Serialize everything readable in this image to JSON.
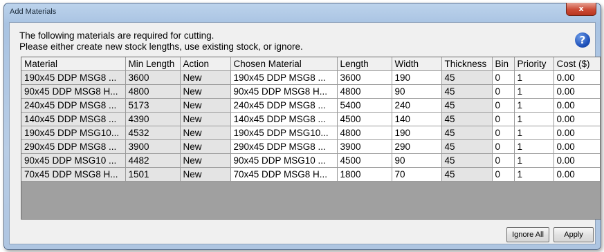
{
  "dialog": {
    "title": "Add Materials",
    "close_label": "x",
    "message_line1": "The following materials are required for cutting.",
    "message_line2": "Please either create new stock lengths, use existing stock, or ignore.",
    "help_label": "?"
  },
  "table": {
    "columns": [
      "Material",
      "Min Length",
      "Action",
      "Chosen Material",
      "Length",
      "Width",
      "Thickness",
      "Bin",
      "Priority",
      "Cost ($)"
    ],
    "rows": [
      [
        "190x45 DDP MSG8 ...",
        "3600",
        "New",
        "190x45 DDP MSG8 ...",
        "3600",
        "190",
        "45",
        "0",
        "1",
        "0.00"
      ],
      [
        "90x45 DDP MSG8 H...",
        "4800",
        "New",
        "90x45 DDP MSG8 H...",
        "4800",
        "90",
        "45",
        "0",
        "1",
        "0.00"
      ],
      [
        "240x45 DDP MSG8 ...",
        "5173",
        "New",
        "240x45 DDP MSG8 ...",
        "5400",
        "240",
        "45",
        "0",
        "1",
        "0.00"
      ],
      [
        "140x45 DDP MSG8 ...",
        "4390",
        "New",
        "140x45 DDP MSG8 ...",
        "4500",
        "140",
        "45",
        "0",
        "1",
        "0.00"
      ],
      [
        "190x45 DDP MSG10...",
        "4532",
        "New",
        "190x45 DDP MSG10...",
        "4800",
        "190",
        "45",
        "0",
        "1",
        "0.00"
      ],
      [
        "290x45 DDP MSG8 ...",
        "3900",
        "New",
        "290x45 DDP MSG8 ...",
        "3900",
        "290",
        "45",
        "0",
        "1",
        "0.00"
      ],
      [
        "90x45 DDP MSG10 ...",
        "4482",
        "New",
        "90x45 DDP MSG10 ...",
        "4500",
        "90",
        "45",
        "0",
        "1",
        "0.00"
      ],
      [
        "70x45 DDP MSG8 H...",
        "1501",
        "New",
        "70x45 DDP MSG8 H...",
        "1800",
        "70",
        "45",
        "0",
        "1",
        "0.00"
      ]
    ]
  },
  "buttons": {
    "ignore_all": "Ignore All",
    "apply": "Apply"
  }
}
